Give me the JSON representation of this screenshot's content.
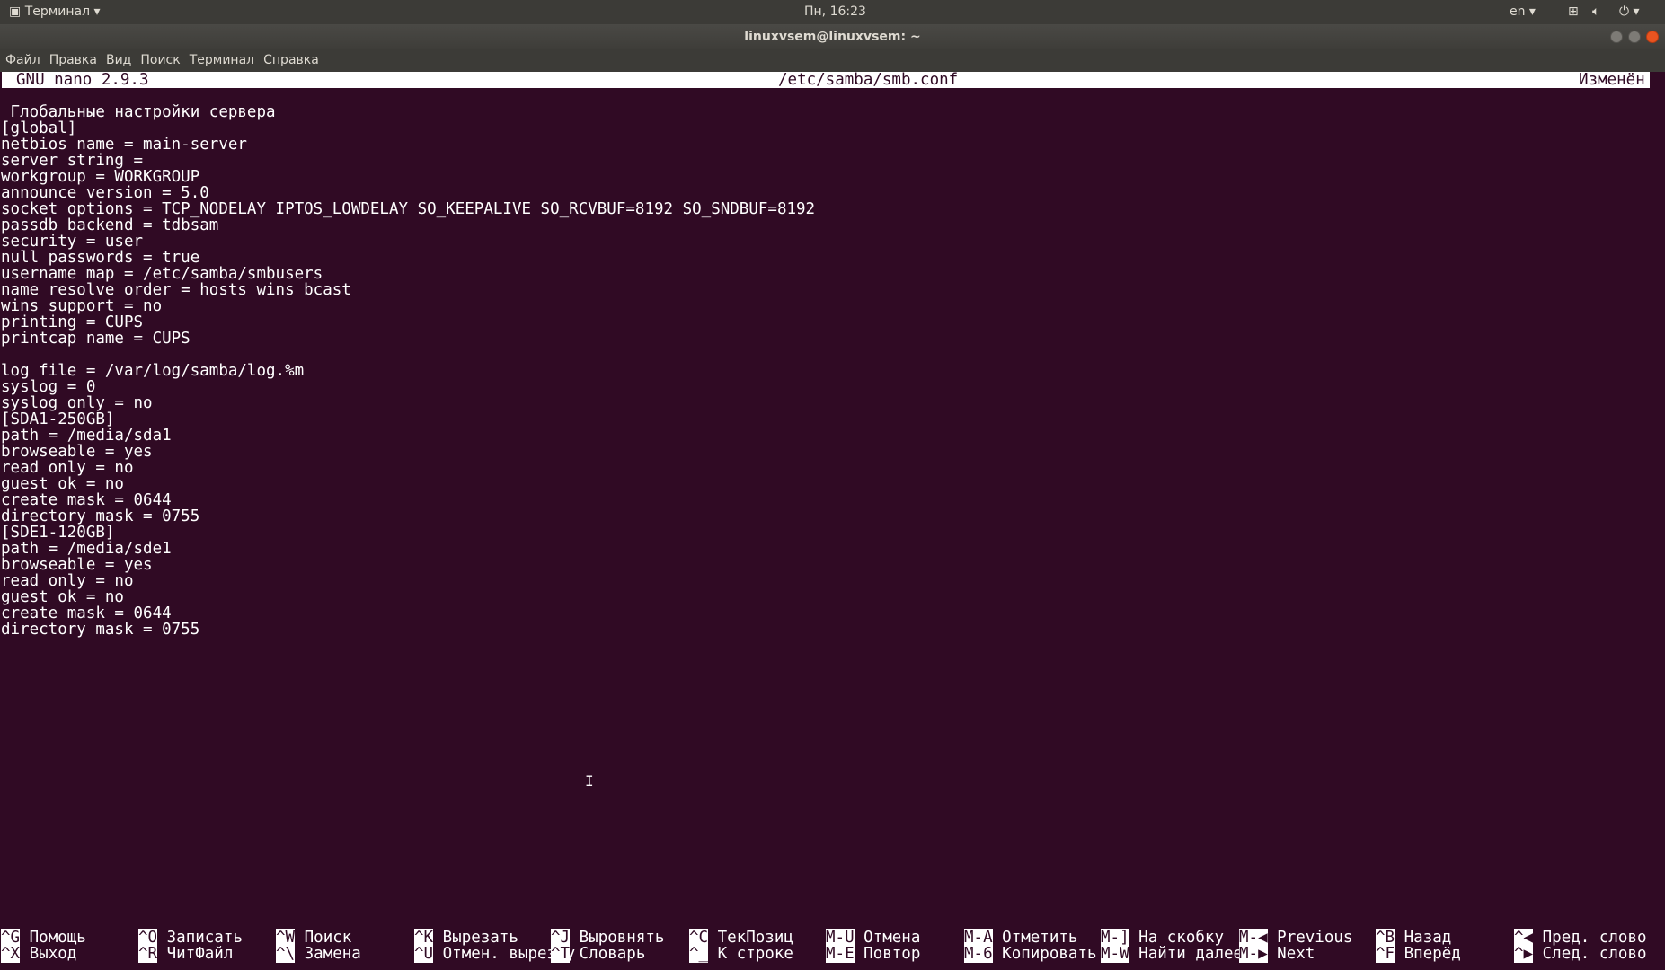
{
  "topbar": {
    "app": "Терминал ▾",
    "clock": "Пн, 16:23",
    "lang": "en ▾",
    "icons": [
      "network-icon",
      "volume-icon",
      "power-icon"
    ]
  },
  "window": {
    "title": "linuxvsem@linuxvsem: ~"
  },
  "menu": [
    "Файл",
    "Правка",
    "Вид",
    "Поиск",
    "Терминал",
    "Справка"
  ],
  "nano": {
    "version": "GNU nano 2.9.3",
    "file": "/etc/samba/smb.conf",
    "status": "Изменён"
  },
  "lines": [
    " Глобальные настройки сервера",
    "[global]",
    "netbios name = main-server",
    "server string =",
    "workgroup = WORKGROUP",
    "announce version = 5.0",
    "socket options = TCP_NODELAY IPTOS_LOWDELAY SO_KEEPALIVE SO_RCVBUF=8192 SO_SNDBUF=8192",
    "passdb backend = tdbsam",
    "security = user",
    "null passwords = true",
    "username map = /etc/samba/smbusers",
    "name resolve order = hosts wins bcast",
    "wins support = no",
    "printing = CUPS",
    "printcap name = CUPS",
    "",
    "log file = /var/log/samba/log.%m",
    "syslog = 0",
    "syslog only = no",
    "[SDA1-250GB]",
    "path = /media/sda1",
    "browseable = yes",
    "read only = no",
    "guest ok = no",
    "create mask = 0644",
    "directory mask = 0755",
    "[SDE1-120GB]",
    "path = /media/sde1",
    "browseable = yes",
    "read only = no",
    "guest ok = no",
    "create mask = 0644",
    "directory mask = 0755"
  ],
  "shortcuts": [
    [
      {
        "k": "^G",
        "l": "Помощь"
      },
      {
        "k": "^X",
        "l": "Выход"
      }
    ],
    [
      {
        "k": "^O",
        "l": "Записать"
      },
      {
        "k": "^R",
        "l": "ЧитФайл"
      }
    ],
    [
      {
        "k": "^W",
        "l": "Поиск"
      },
      {
        "k": "^\\",
        "l": "Замена"
      }
    ],
    [
      {
        "k": "^K",
        "l": "Вырезать"
      },
      {
        "k": "^U",
        "l": "Отмен. вырезку"
      }
    ],
    [
      {
        "k": "^J",
        "l": "Выровнять"
      },
      {
        "k": "^T",
        "l": "Словарь"
      }
    ],
    [
      {
        "k": "^C",
        "l": "ТекПозиц"
      },
      {
        "k": "^_",
        "l": "К строке"
      }
    ],
    [
      {
        "k": "M-U",
        "l": "Отмена"
      },
      {
        "k": "M-E",
        "l": "Повтор"
      }
    ],
    [
      {
        "k": "M-A",
        "l": "Отметить"
      },
      {
        "k": "M-6",
        "l": "Копировать"
      }
    ],
    [
      {
        "k": "M-]",
        "l": "На скобку"
      },
      {
        "k": "M-W",
        "l": "Найти далее"
      }
    ],
    [
      {
        "k": "M-◀",
        "l": "Previous"
      },
      {
        "k": "M-▶",
        "l": "Next"
      }
    ],
    [
      {
        "k": "^B",
        "l": "Назад"
      },
      {
        "k": "^F",
        "l": "Вперёд"
      }
    ],
    [
      {
        "k": "^◀",
        "l": "Пред. слово"
      },
      {
        "k": "^▶",
        "l": "След. слово"
      }
    ]
  ]
}
